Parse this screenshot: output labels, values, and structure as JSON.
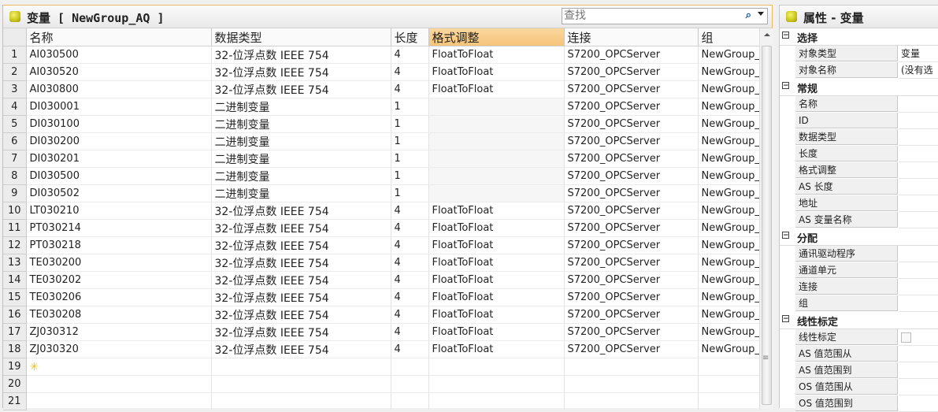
{
  "left_panel": {
    "title": "变量 [ NewGroup_AQ ]",
    "search_placeholder": "查找",
    "columns": [
      "名称",
      "数据类型",
      "长度",
      "格式调整",
      "连接",
      "组"
    ],
    "rows": [
      {
        "n": "1",
        "name": "AI030500",
        "type": "32-位浮点数 IEEE 754",
        "len": "4",
        "fmt": "FloatToFloat",
        "conn": "S7200_OPCServer",
        "group": "NewGroup_"
      },
      {
        "n": "2",
        "name": "AI030520",
        "type": "32-位浮点数 IEEE 754",
        "len": "4",
        "fmt": "FloatToFloat",
        "conn": "S7200_OPCServer",
        "group": "NewGroup_"
      },
      {
        "n": "3",
        "name": "AI030800",
        "type": "32-位浮点数 IEEE 754",
        "len": "4",
        "fmt": "FloatToFloat",
        "conn": "S7200_OPCServer",
        "group": "NewGroup_"
      },
      {
        "n": "4",
        "name": "DI030001",
        "type": "二进制变量",
        "len": "1",
        "fmt": "",
        "conn": "S7200_OPCServer",
        "group": "NewGroup_"
      },
      {
        "n": "5",
        "name": "DI030100",
        "type": "二进制变量",
        "len": "1",
        "fmt": "",
        "conn": "S7200_OPCServer",
        "group": "NewGroup_"
      },
      {
        "n": "6",
        "name": "DI030200",
        "type": "二进制变量",
        "len": "1",
        "fmt": "",
        "conn": "S7200_OPCServer",
        "group": "NewGroup_"
      },
      {
        "n": "7",
        "name": "DI030201",
        "type": "二进制变量",
        "len": "1",
        "fmt": "",
        "conn": "S7200_OPCServer",
        "group": "NewGroup_"
      },
      {
        "n": "8",
        "name": "DI030500",
        "type": "二进制变量",
        "len": "1",
        "fmt": "",
        "conn": "S7200_OPCServer",
        "group": "NewGroup_"
      },
      {
        "n": "9",
        "name": "DI030502",
        "type": "二进制变量",
        "len": "1",
        "fmt": "",
        "conn": "S7200_OPCServer",
        "group": "NewGroup_"
      },
      {
        "n": "10",
        "name": "LT030210",
        "type": "32-位浮点数 IEEE 754",
        "len": "4",
        "fmt": "FloatToFloat",
        "conn": "S7200_OPCServer",
        "group": "NewGroup_"
      },
      {
        "n": "11",
        "name": "PT030214",
        "type": "32-位浮点数 IEEE 754",
        "len": "4",
        "fmt": "FloatToFloat",
        "conn": "S7200_OPCServer",
        "group": "NewGroup_"
      },
      {
        "n": "12",
        "name": "PT030218",
        "type": "32-位浮点数 IEEE 754",
        "len": "4",
        "fmt": "FloatToFloat",
        "conn": "S7200_OPCServer",
        "group": "NewGroup_"
      },
      {
        "n": "13",
        "name": "TE030200",
        "type": "32-位浮点数 IEEE 754",
        "len": "4",
        "fmt": "FloatToFloat",
        "conn": "S7200_OPCServer",
        "group": "NewGroup_"
      },
      {
        "n": "14",
        "name": "TE030202",
        "type": "32-位浮点数 IEEE 754",
        "len": "4",
        "fmt": "FloatToFloat",
        "conn": "S7200_OPCServer",
        "group": "NewGroup_"
      },
      {
        "n": "15",
        "name": "TE030206",
        "type": "32-位浮点数 IEEE 754",
        "len": "4",
        "fmt": "FloatToFloat",
        "conn": "S7200_OPCServer",
        "group": "NewGroup_"
      },
      {
        "n": "16",
        "name": "TE030208",
        "type": "32-位浮点数 IEEE 754",
        "len": "4",
        "fmt": "FloatToFloat",
        "conn": "S7200_OPCServer",
        "group": "NewGroup_"
      },
      {
        "n": "17",
        "name": "ZJ030312",
        "type": "32-位浮点数 IEEE 754",
        "len": "4",
        "fmt": "FloatToFloat",
        "conn": "S7200_OPCServer",
        "group": "NewGroup_"
      },
      {
        "n": "18",
        "name": "ZJ030320",
        "type": "32-位浮点数 IEEE 754",
        "len": "4",
        "fmt": "FloatToFloat",
        "conn": "S7200_OPCServer",
        "group": "NewGroup_"
      }
    ],
    "empty_rows": [
      "19",
      "20",
      "21"
    ],
    "new_row_icon": "new-row-star-icon"
  },
  "right_panel": {
    "title": "属性 - 变量",
    "sections": [
      {
        "label": "选择",
        "items": [
          {
            "label": "对象类型",
            "value": "变量"
          },
          {
            "label": "对象名称",
            "value": "(没有选"
          }
        ]
      },
      {
        "label": "常规",
        "items": [
          {
            "label": "名称",
            "value": ""
          },
          {
            "label": "ID",
            "value": ""
          },
          {
            "label": "数据类型",
            "value": ""
          },
          {
            "label": "长度",
            "value": ""
          },
          {
            "label": "格式调整",
            "value": ""
          },
          {
            "label": "AS 长度",
            "value": ""
          },
          {
            "label": "地址",
            "value": ""
          },
          {
            "label": "AS 变量名称",
            "value": ""
          }
        ]
      },
      {
        "label": "分配",
        "items": [
          {
            "label": "通讯驱动程序",
            "value": ""
          },
          {
            "label": "通道单元",
            "value": ""
          },
          {
            "label": "连接",
            "value": ""
          },
          {
            "label": "组",
            "value": ""
          }
        ]
      },
      {
        "label": "线性标定",
        "items": [
          {
            "label": "线性标定",
            "value": "",
            "checkbox": true
          },
          {
            "label": "AS 值范围从",
            "value": ""
          },
          {
            "label": "AS 值范围到",
            "value": ""
          },
          {
            "label": "OS 值范围从",
            "value": ""
          },
          {
            "label": "OS 值范围到",
            "value": ""
          }
        ]
      }
    ]
  }
}
